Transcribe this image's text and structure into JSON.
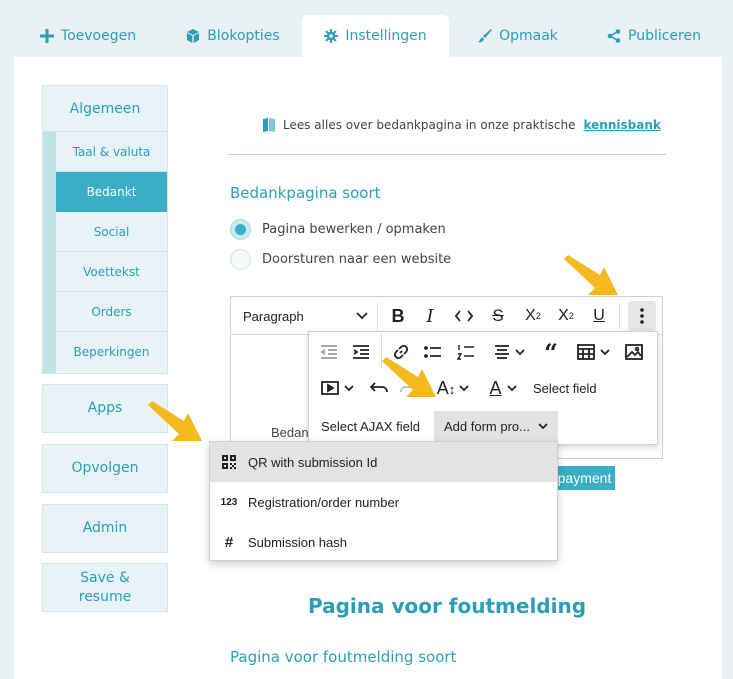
{
  "tabs": [
    {
      "label": "Toevoegen",
      "icon": "plus-icon"
    },
    {
      "label": "Blokopties",
      "icon": "cube-icon"
    },
    {
      "label": "Instellingen",
      "icon": "gear-icon"
    },
    {
      "label": "Opmaak",
      "icon": "brush-icon"
    },
    {
      "label": "Publiceren",
      "icon": "share-icon"
    }
  ],
  "active_tab": "Instellingen",
  "sidebar": {
    "group_title": "Algemeen",
    "items": [
      "Taal & valuta",
      "Bedankt",
      "Social",
      "Voettekst",
      "Orders",
      "Beperkingen"
    ],
    "active_item": "Bedankt",
    "buttons": [
      "Apps",
      "Opvolgen",
      "Admin",
      "Save & resume"
    ]
  },
  "info": {
    "text": "Lees alles over bedankpagina in onze praktische",
    "link": "kennisbank"
  },
  "section": {
    "title": "Bedankpagina soort",
    "options": [
      "Pagina bewerken / opmaken",
      "Doorsturen naar een website"
    ],
    "selected": "Pagina bewerken / opmaken"
  },
  "editor": {
    "paragraph_select": "Paragraph",
    "body_text_fragment": "Bedan",
    "popup": {
      "select_field": "Select field",
      "select_ajax_field": "Select AJAX field",
      "add_form_property": "Add form pro..."
    },
    "dropdown": [
      {
        "icon": "qr-icon",
        "label": "QR with submission Id"
      },
      {
        "icon": "123",
        "label": "Registration/order number"
      },
      {
        "icon": "hash-icon",
        "label": "Submission hash"
      }
    ],
    "payment_button": "payment"
  },
  "section2": {
    "heading": "Pagina voor foutmelding",
    "title": "Pagina voor foutmelding soort"
  },
  "colors": {
    "accent": "#2b9fb8",
    "active": "#3aaec4",
    "arrow": "#f3b91e"
  }
}
